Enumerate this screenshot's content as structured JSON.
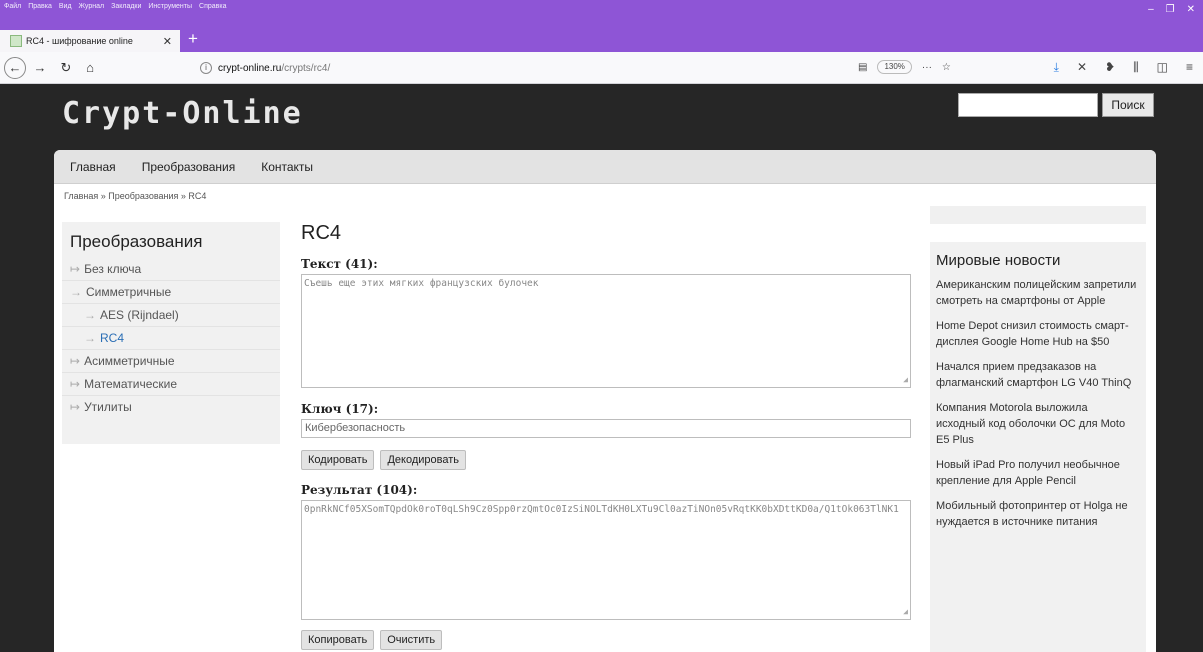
{
  "browser": {
    "menu": [
      "Файл",
      "Правка",
      "Вид",
      "Журнал",
      "Закладки",
      "Инструменты",
      "Справка"
    ],
    "tab_title": "RC4 - шифрование online",
    "url_host": "crypt-online.ru",
    "url_path": "/crypts/rc4/",
    "zoom": "130%",
    "window_controls": [
      "–",
      "❐",
      "✕"
    ]
  },
  "site": {
    "logo": "Crypt-Online",
    "search_button": "Поиск",
    "nav": [
      "Главная",
      "Преобразования",
      "Контакты"
    ],
    "breadcrumbs": "Главная » Преобразования » RC4"
  },
  "sidebar": {
    "title": "Преобразования",
    "items": [
      {
        "label": "Без ключа",
        "sub": false,
        "active": false
      },
      {
        "label": "Симметричные",
        "sub": false,
        "active": false
      },
      {
        "label": "AES (Rijndael)",
        "sub": true,
        "active": false
      },
      {
        "label": "RC4",
        "sub": true,
        "active": true
      },
      {
        "label": "Асимметричные",
        "sub": false,
        "active": false
      },
      {
        "label": "Математические",
        "sub": false,
        "active": false
      },
      {
        "label": "Утилиты",
        "sub": false,
        "active": false
      }
    ]
  },
  "main": {
    "title": "RC4",
    "text_label": "Текст (41):",
    "text_value": "Съешь еще этих мягких французских булочек",
    "key_label": "Ключ (17):",
    "key_value": "Кибербезопасность",
    "encode_button": "Кодировать",
    "decode_button": "Декодировать",
    "result_label": "Результат (104):",
    "result_value": "0pnRkNCf05XSomTQpdOk0roT0qLSh9Cz0Spp0rzQmtOc0IzSiNOLTdKH0LXTu9Cl0azTiNOn05vRqtKK0bXDttKD0a/Q1tOk063TlNK1",
    "copy_button": "Копировать",
    "clear_button": "Очистить"
  },
  "news": {
    "title": "Мировые новости",
    "items": [
      "Американским полицейским запретили смотреть на смартфоны от Apple",
      "Home Depot снизил стоимость смарт-дисплея Google Home Hub на $50",
      "Начался прием предзаказов на флагманский смартфон LG V40 ThinQ",
      "Компания Motorola выложила исходный код оболочки ОС для Moto E5 Plus",
      "Новый iPad Pro получил необычное крепление для Apple Pencil",
      "Мобильный фотопринтер от Holga не нуждается в источнике питания"
    ]
  }
}
